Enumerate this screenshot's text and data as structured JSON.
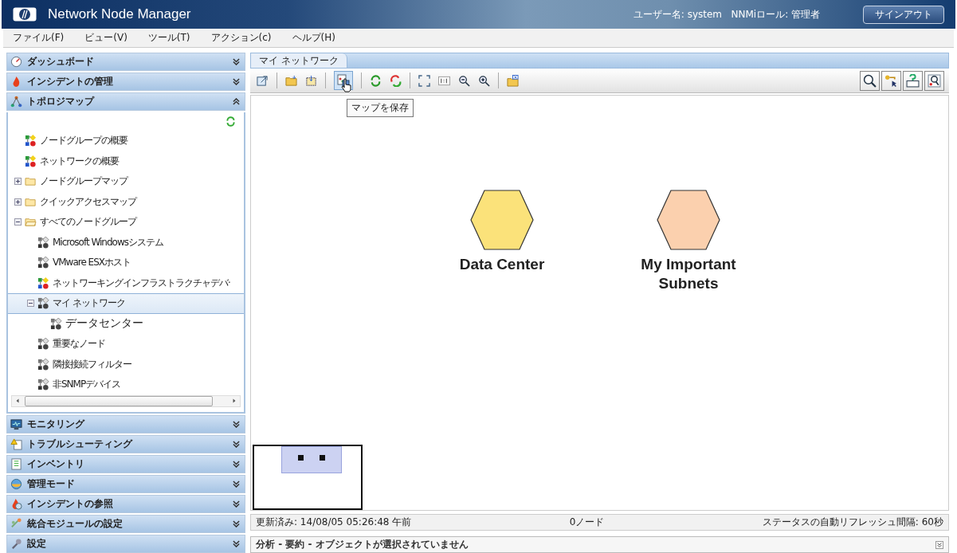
{
  "header": {
    "title": "Network Node Manager",
    "user_info": "ユーザー名: system   NNMiロール: 管理者",
    "signout_button": "サインアウト"
  },
  "menu": [
    "ファイル(F)",
    "ビュー(V)",
    "ツール(T)",
    "アクション(c)",
    "ヘルプ(H)"
  ],
  "sidebar": {
    "sections": [
      {
        "label": "ダッシュボード",
        "kind": "gauge",
        "expanded": false
      },
      {
        "label": "インシデントの管理",
        "kind": "flame",
        "expanded": false
      },
      {
        "label": "トポロジマップ",
        "kind": "topology",
        "expanded": true
      },
      {
        "label": "モニタリング",
        "kind": "monitor",
        "expanded": false
      },
      {
        "label": "トラブルシューティング",
        "kind": "warning",
        "expanded": false
      },
      {
        "label": "インベントリ",
        "kind": "list",
        "expanded": false
      },
      {
        "label": "管理モード",
        "kind": "globe",
        "expanded": false
      },
      {
        "label": "インシデントの参照",
        "kind": "flame-clock",
        "expanded": false
      },
      {
        "label": "統合モジュールの設定",
        "kind": "plug",
        "expanded": false
      },
      {
        "label": "設定",
        "kind": "wrench",
        "expanded": false
      }
    ],
    "tree": [
      {
        "label": "ノードグループの概要",
        "kind": "colored-map",
        "selected": false
      },
      {
        "label": "ネットワークの概要",
        "kind": "colored-map",
        "selected": false
      },
      {
        "label": "ノードグループマップ",
        "kind": "folder",
        "expanded": false,
        "selected": false
      },
      {
        "label": "クイックアクセスマップ",
        "kind": "folder",
        "expanded": false,
        "selected": false
      },
      {
        "label": "すべてのノードグループ",
        "kind": "folder",
        "expanded": true,
        "selected": false,
        "children": [
          {
            "label": "Microsoft Windowsシステム",
            "kind": "gray-map",
            "selected": false
          },
          {
            "label": "VMware ESXホスト",
            "kind": "gray-map",
            "selected": false
          },
          {
            "label": "ネットワーキングインフラストラクチャデバ·",
            "kind": "colored-map",
            "selected": false
          },
          {
            "label": "マイ ネットワーク",
            "kind": "gray-map",
            "expanded": true,
            "selected": true,
            "children": [
              {
                "label": "データセンター",
                "kind": "gray-map",
                "selected": false
              }
            ]
          },
          {
            "label": "重要なノード",
            "kind": "gray-map",
            "selected": false
          },
          {
            "label": "隣接接続フィルター",
            "kind": "gray-map",
            "selected": false
          },
          {
            "label": "非SNMPデバイス",
            "kind": "gray-map",
            "selected": false
          }
        ]
      }
    ]
  },
  "main": {
    "tab": "マイ ネットワーク",
    "tooltip": "マップを保存",
    "nodes": [
      {
        "label": "Data Center",
        "color": "#fbe27a"
      },
      {
        "label": "My Important Subnets",
        "color": "#fbd0ae"
      }
    ],
    "status_bar": {
      "updated": "更新済み: 14/08/05 05:26:48 午前",
      "node_count": "0ノード",
      "refresh_interval": "ステータスの自動リフレッシュ間隔: 60秒"
    },
    "analysis_bar": "分析 - 要約 - オブジェクトが選択されていません"
  }
}
